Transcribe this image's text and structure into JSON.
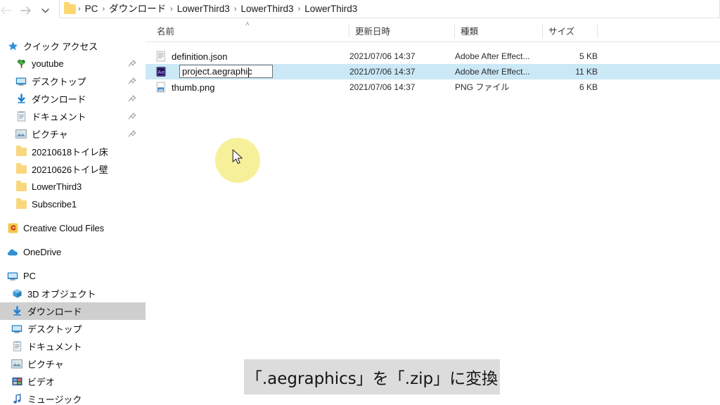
{
  "window": {
    "app": "File Explorer"
  },
  "toolbar": {
    "back_icon": "arrow-left-icon",
    "forward_icon": "arrow-right-icon",
    "recent_icon": "chevron-down-icon",
    "up_icon": "arrow-up-icon"
  },
  "breadcrumb": {
    "folder_icon": "folder-icon",
    "separator": "›",
    "items": [
      {
        "label": "PC"
      },
      {
        "label": "ダウンロード"
      },
      {
        "label": "LowerThird3"
      },
      {
        "label": "LowerThird3"
      },
      {
        "label": "LowerThird3"
      }
    ]
  },
  "sidebar": {
    "items": [
      {
        "label": "クイック アクセス",
        "icon": "star-icon",
        "indent": 1,
        "pinned": false,
        "selected": false
      },
      {
        "label": "youtube",
        "icon": "tree-icon",
        "indent": 2,
        "pinned": true,
        "selected": false
      },
      {
        "label": "デスクトップ",
        "icon": "desktop-icon",
        "indent": 2,
        "pinned": true,
        "selected": false
      },
      {
        "label": "ダウンロード",
        "icon": "download-icon",
        "indent": 2,
        "pinned": true,
        "selected": false
      },
      {
        "label": "ドキュメント",
        "icon": "documents-icon",
        "indent": 2,
        "pinned": true,
        "selected": false
      },
      {
        "label": "ピクチャ",
        "icon": "pictures-icon",
        "indent": 2,
        "pinned": true,
        "selected": false
      },
      {
        "label": "20210618トイレ床",
        "icon": "folder-icon",
        "indent": 2,
        "pinned": false,
        "selected": false
      },
      {
        "label": "20210626トイレ壁",
        "icon": "folder-icon",
        "indent": 2,
        "pinned": false,
        "selected": false
      },
      {
        "label": "LowerThird3",
        "icon": "folder-icon",
        "indent": 2,
        "pinned": false,
        "selected": false
      },
      {
        "label": "Subscribe1",
        "icon": "folder-icon",
        "indent": 2,
        "pinned": false,
        "selected": false
      },
      {
        "label": "Creative Cloud Files",
        "icon": "creative-cloud-icon",
        "indent": 1,
        "pinned": false,
        "selected": false
      },
      {
        "label": "OneDrive",
        "icon": "onedrive-icon",
        "indent": 1,
        "pinned": false,
        "selected": false
      },
      {
        "label": "PC",
        "icon": "pc-icon",
        "indent": 1,
        "pinned": false,
        "selected": false
      },
      {
        "label": "3D オブジェクト",
        "icon": "3d-objects-icon",
        "indent": 3,
        "pinned": false,
        "selected": false
      },
      {
        "label": "ダウンロード",
        "icon": "download-icon",
        "indent": 3,
        "pinned": false,
        "selected": true
      },
      {
        "label": "デスクトップ",
        "icon": "desktop-icon",
        "indent": 3,
        "pinned": false,
        "selected": false
      },
      {
        "label": "ドキュメント",
        "icon": "documents-icon",
        "indent": 3,
        "pinned": false,
        "selected": false
      },
      {
        "label": "ピクチャ",
        "icon": "pictures-icon",
        "indent": 3,
        "pinned": false,
        "selected": false
      },
      {
        "label": "ビデオ",
        "icon": "videos-icon",
        "indent": 3,
        "pinned": false,
        "selected": false
      },
      {
        "label": "ミュージック",
        "icon": "music-icon",
        "indent": 3,
        "pinned": false,
        "selected": false
      }
    ]
  },
  "filelist": {
    "columns": [
      {
        "label": "名前",
        "key": "name"
      },
      {
        "label": "更新日時",
        "key": "date"
      },
      {
        "label": "種類",
        "key": "type"
      },
      {
        "label": "サイズ",
        "key": "size"
      }
    ],
    "sort_column": "名前",
    "sort_direction": "ascending",
    "sort_caret": "˄",
    "rows": [
      {
        "name": "definition.json",
        "date": "2021/07/06 14:37",
        "type": "Adobe After Effect...",
        "size": "5 KB",
        "icon": "json-file-icon",
        "selected": false,
        "renaming": false
      },
      {
        "name": "project.aegraphic",
        "date": "2021/07/06 14:37",
        "type": "Adobe After Effect...",
        "size": "11 KB",
        "icon": "after-effects-file-icon",
        "selected": true,
        "renaming": true
      },
      {
        "name": "thumb.png",
        "date": "2021/07/06 14:37",
        "type": "PNG ファイル",
        "size": "6 KB",
        "icon": "png-file-icon",
        "selected": false,
        "renaming": false
      }
    ],
    "rename_value": "project.aegraphic"
  },
  "cursor": {
    "icon": "mouse-pointer-icon",
    "highlight_color": "#f7f09a"
  },
  "caption": {
    "text": "「.aegraphics」を「.zip」に変換",
    "background_color": "#dcdcdc"
  },
  "colors": {
    "selection_blue": "#cbe8f7",
    "sidebar_selection_gray": "#cfcfcf",
    "folder_yellow": "#f9d77e",
    "accent_blue": "#1a73c7"
  }
}
